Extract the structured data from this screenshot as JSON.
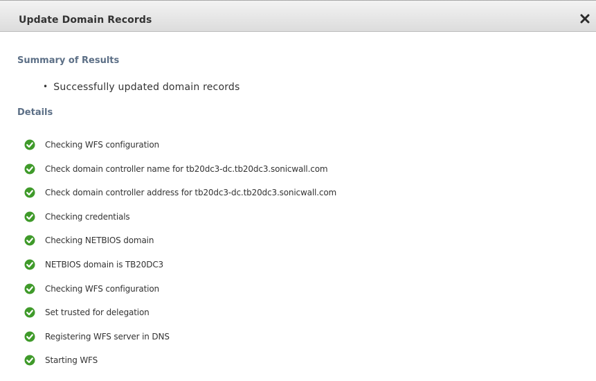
{
  "dialog": {
    "title": "Update Domain Records",
    "close_icon": "close-x-icon"
  },
  "summary": {
    "heading": "Summary of Results",
    "items": [
      "Successfully updated domain records"
    ]
  },
  "details": {
    "heading": "Details",
    "status_icon": "check-circle-icon",
    "status_color": "#3f9a2a",
    "items": [
      "Checking WFS configuration",
      "Check domain controller name for tb20dc3-dc.tb20dc3.sonicwall.com",
      "Check domain controller address for tb20dc3-dc.tb20dc3.sonicwall.com",
      "Checking credentials",
      "Checking NETBIOS domain",
      "NETBIOS domain is TB20DC3",
      "Checking WFS configuration",
      "Set trusted for delegation",
      "Registering WFS server in DNS",
      "Starting WFS"
    ]
  },
  "colors": {
    "section_heading": "#5c6f86",
    "title_bar": "#e6e6e6",
    "text": "#333333"
  }
}
